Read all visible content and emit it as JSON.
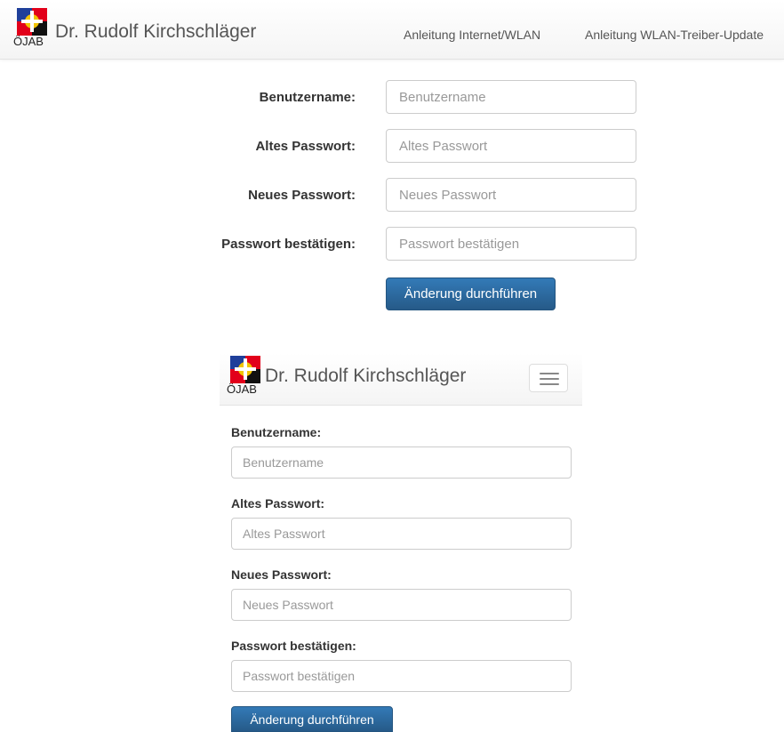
{
  "brand": {
    "name": "Dr. Rudolf Kirchschläger",
    "logo_text": "ÖJAB"
  },
  "nav": {
    "links": [
      "Anleitung Internet/WLAN",
      "Anleitung WLAN-Treiber-Update"
    ]
  },
  "form": {
    "fields": [
      {
        "label": "Benutzername:",
        "placeholder": "Benutzername"
      },
      {
        "label": "Altes Passwort:",
        "placeholder": "Altes Passwort"
      },
      {
        "label": "Neues Passwort:",
        "placeholder": "Neues Passwort"
      },
      {
        "label": "Passwort bestätigen:",
        "placeholder": "Passwort bestätigen"
      }
    ],
    "submit_label": "Änderung durchführen"
  },
  "colors": {
    "primary": "#337ab7",
    "logo_red": "#e2001a",
    "logo_blue": "#1f3f9a",
    "logo_yellow": "#f2c400"
  },
  "icons": {
    "menu": "hamburger-icon"
  }
}
